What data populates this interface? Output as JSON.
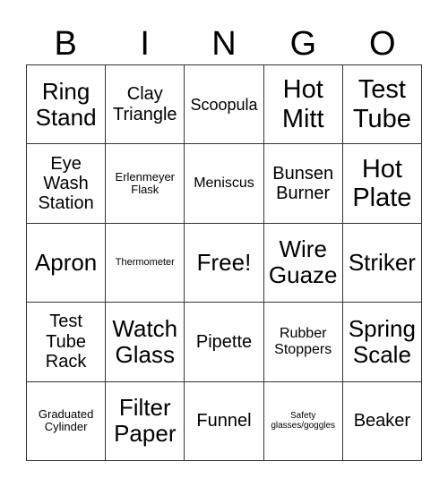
{
  "header": {
    "letters": [
      "B",
      "I",
      "N",
      "G",
      "O"
    ]
  },
  "cells": [
    [
      "Ring Stand",
      "Clay Triangle",
      "Scoopula",
      "Hot Mitt",
      "Test Tube"
    ],
    [
      "Eye Wash Station",
      "Erlenmeyer Flask",
      "Meniscus",
      "Bunsen Burner",
      "Hot Plate"
    ],
    [
      "Apron",
      "Thermometer",
      "Free!",
      "Wire Guaze",
      "Striker"
    ],
    [
      "Test Tube Rack",
      "Watch Glass",
      "Pipette",
      "Rubber Stoppers",
      "Spring Scale"
    ],
    [
      "Graduated Cylinder",
      "Filter Paper",
      "Funnel",
      "Safety glasses/goggles",
      "Beaker"
    ]
  ]
}
